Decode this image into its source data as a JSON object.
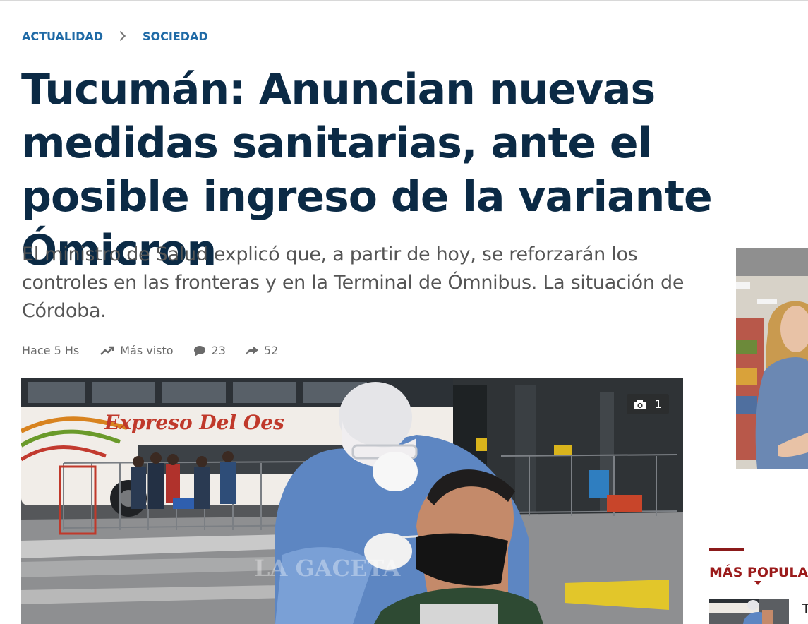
{
  "breadcrumb": {
    "section": "ACTUALIDAD",
    "subsection": "SOCIEDAD"
  },
  "article": {
    "title": "Tucumán: Anuncian nuevas medidas sanitarias, ante el posible ingreso de la variante Ómicron",
    "subtitle": "El ministro de Salud explicó que, a partir de hoy, se reforzarán los controles en las fronteras y en la Terminal de Ómnibus. La situación de Córdoba.",
    "time": "Hace 5 Hs",
    "trending_label": "Más visto",
    "comments": "23",
    "shares": "52"
  },
  "photo": {
    "count": "1",
    "bus_lettering": "Expreso Del Oes",
    "watermark": "LA GACETA"
  },
  "sidebar": {
    "popular_heading": "MÁS POPULAR",
    "first_item_initial": "T"
  },
  "colors": {
    "breadcrumb": "#1f6aa6",
    "title": "#0b2a45",
    "accent": "#9b1b1b"
  }
}
